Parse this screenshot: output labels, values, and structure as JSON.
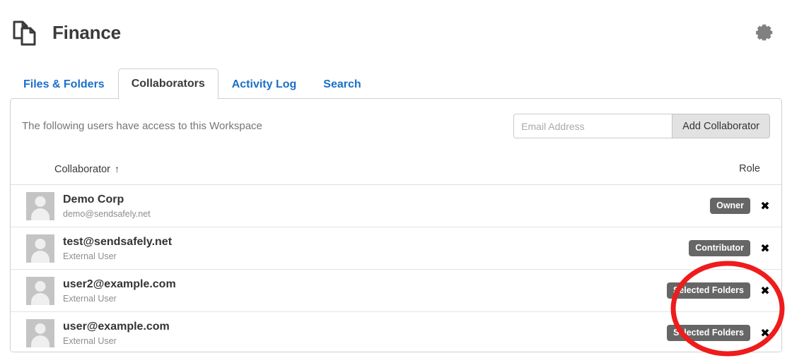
{
  "header": {
    "title": "Finance",
    "workspace_icon": "two-documents-icon",
    "settings_icon": "gear-icon"
  },
  "tabs": [
    {
      "label": "Files & Folders",
      "active": false
    },
    {
      "label": "Collaborators",
      "active": true
    },
    {
      "label": "Activity Log",
      "active": false
    },
    {
      "label": "Search",
      "active": false
    }
  ],
  "panel": {
    "note": "The following users have access to this Workspace",
    "email_input": {
      "value": "",
      "placeholder": "Email Address"
    },
    "add_button": "Add Collaborator"
  },
  "table": {
    "columns": {
      "collaborator": "Collaborator",
      "sort_indicator": "↑",
      "role": "Role"
    },
    "rows": [
      {
        "name": "Demo Corp",
        "sub": "demo@sendsafely.net",
        "role": "Owner",
        "remove": "✖"
      },
      {
        "name": "test@sendsafely.net",
        "sub": "External User",
        "role": "Contributor",
        "remove": "✖"
      },
      {
        "name": "user2@example.com",
        "sub": "External User",
        "role": "Selected Folders",
        "remove": "✖"
      },
      {
        "name": "user@example.com",
        "sub": "External User",
        "role": "Selected Folders",
        "remove": "✖"
      }
    ]
  },
  "annotation": {
    "shape": "ellipse",
    "color": "#ee1c1c",
    "target": "Selected Folders role badges"
  },
  "colors": {
    "tab_link": "#1a70c8",
    "badge_bg": "#666666",
    "annotation_red": "#ee1c1c"
  }
}
